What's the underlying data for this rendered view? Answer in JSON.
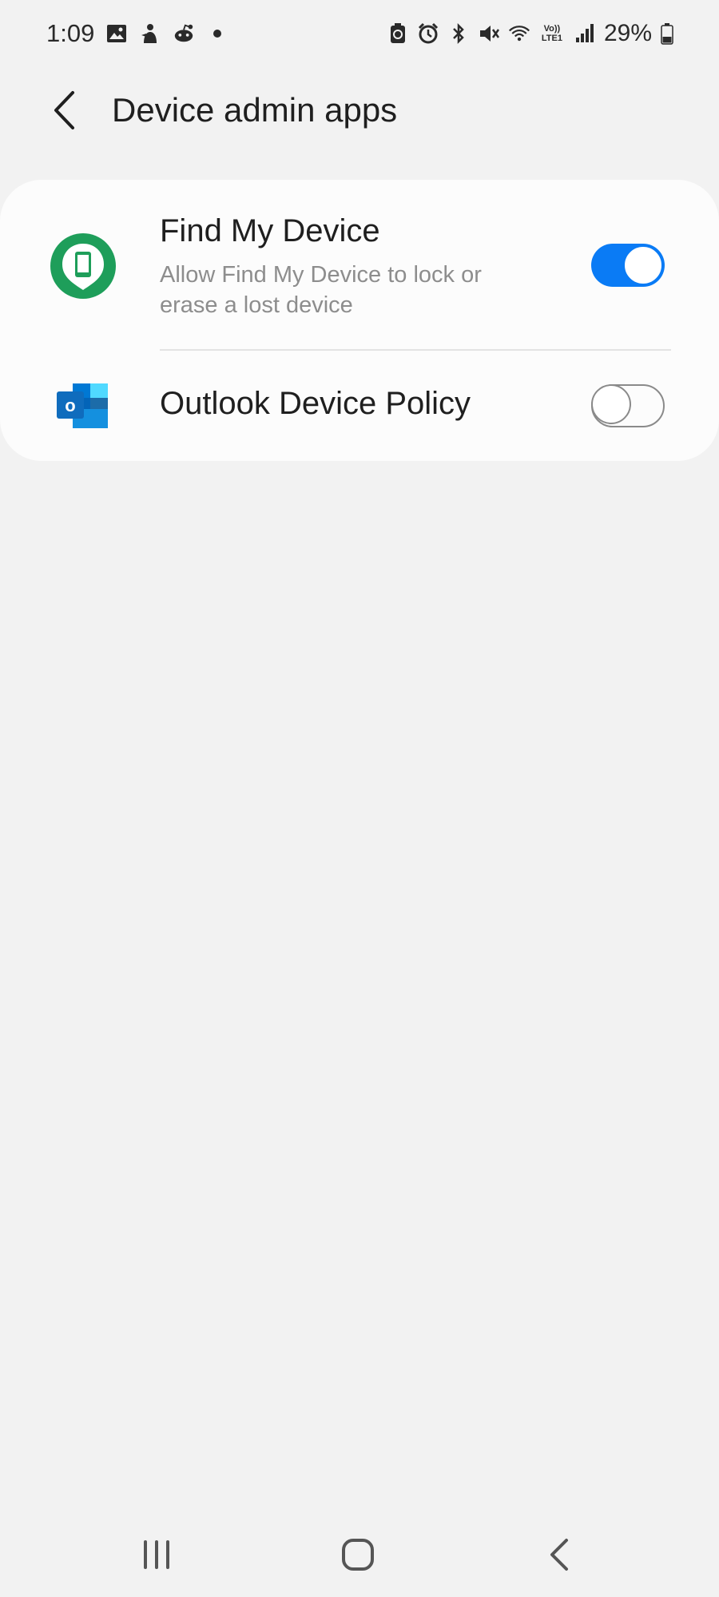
{
  "status_bar": {
    "time": "1:09",
    "battery_percent": "29%",
    "left_icons": [
      "gallery-icon",
      "bixby-icon",
      "reddit-icon",
      "dot-icon"
    ],
    "right_icons": [
      "battery-saver-icon",
      "alarm-icon",
      "bluetooth-icon",
      "mute-icon",
      "wifi-icon",
      "volte-icon",
      "signal-icon",
      "battery-icon"
    ],
    "volte_label_top": "Vo))",
    "volte_label_bottom": "LTE1"
  },
  "header": {
    "title": "Device admin apps"
  },
  "apps": [
    {
      "name": "Find My Device",
      "description": "Allow Find My Device to lock or erase a lost device",
      "enabled": true,
      "icon": "find-my-device-icon"
    },
    {
      "name": "Outlook Device Policy",
      "description": "",
      "enabled": false,
      "icon": "outlook-icon",
      "icon_letter": "o"
    }
  ],
  "colors": {
    "accent": "#0a7bf5",
    "find_my_device_green": "#1e9e5a",
    "outlook_blue": "#0f6cbd",
    "background": "#f2f2f2"
  },
  "nav_bar": {
    "buttons": [
      "recents-icon",
      "home-icon",
      "back-icon"
    ]
  }
}
